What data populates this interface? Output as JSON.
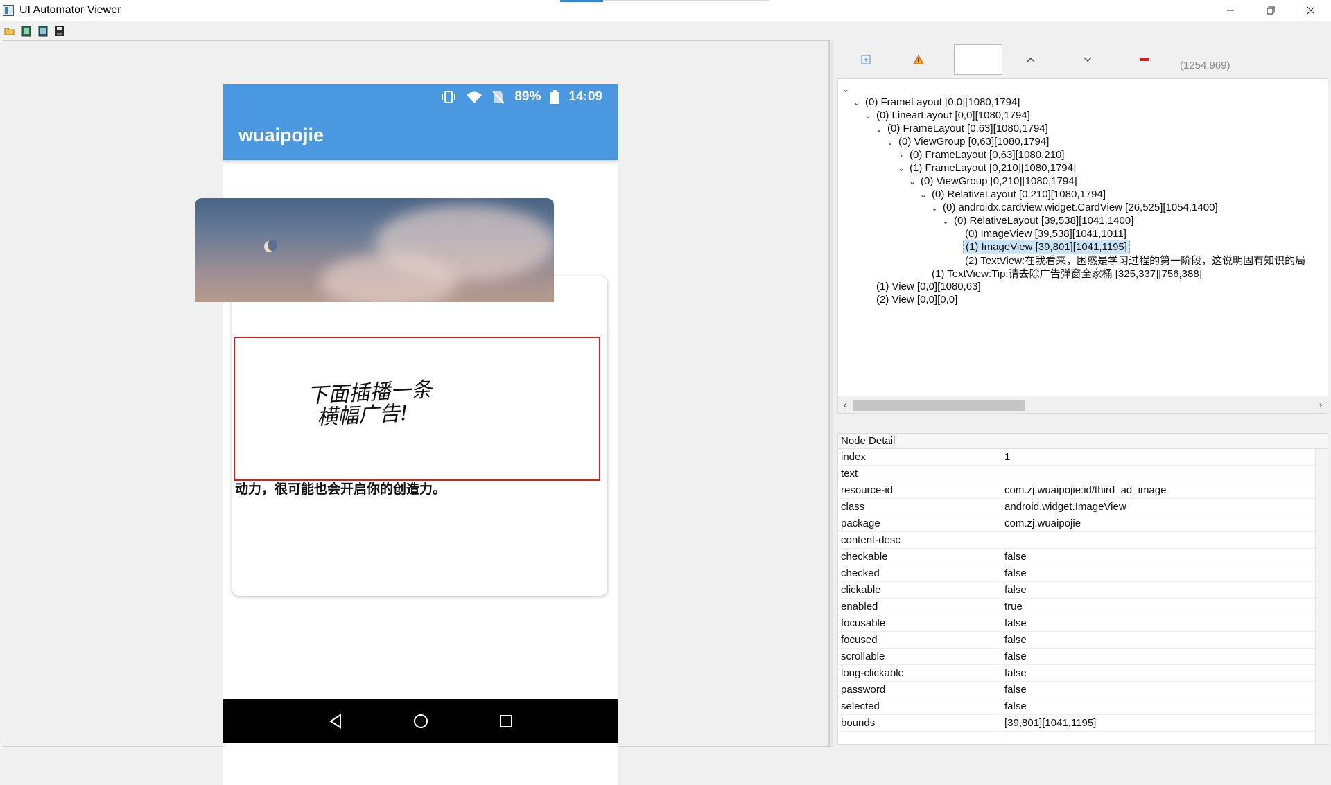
{
  "window": {
    "title": "UI Automator Viewer",
    "controls": [
      "minimize",
      "restore",
      "close"
    ]
  },
  "toolbar": {
    "buttons": [
      "open-icon",
      "device-screenshot-icon",
      "device-screenshot-compressed-icon",
      "save-icon"
    ]
  },
  "device": {
    "status": {
      "battery": "89%",
      "time": "14:09"
    },
    "app_title": "wuaipojie",
    "tip": "Tip:请去除广告弹窗全家桶",
    "ad_text_line1": "下面插播一条",
    "ad_text_line2": "横幅广告!",
    "card_text": "动力，很可能也会开启你的创造力。",
    "nav": [
      "back-icon",
      "home-icon",
      "recents-icon"
    ]
  },
  "hierarchy": {
    "coords": "(1254,969)",
    "nodes": [
      {
        "indent": 0,
        "arrow": "v",
        "label": ""
      },
      {
        "indent": 1,
        "arrow": "v",
        "label": "(0) FrameLayout [0,0][1080,1794]"
      },
      {
        "indent": 2,
        "arrow": "v",
        "label": "(0) LinearLayout [0,0][1080,1794]"
      },
      {
        "indent": 3,
        "arrow": "v",
        "label": "(0) FrameLayout [0,63][1080,1794]"
      },
      {
        "indent": 4,
        "arrow": "v",
        "label": "(0) ViewGroup [0,63][1080,1794]"
      },
      {
        "indent": 5,
        "arrow": ">",
        "label": "(0) FrameLayout [0,63][1080,210]"
      },
      {
        "indent": 5,
        "arrow": "v",
        "label": "(1) FrameLayout [0,210][1080,1794]"
      },
      {
        "indent": 6,
        "arrow": "v",
        "label": "(0) ViewGroup [0,210][1080,1794]"
      },
      {
        "indent": 7,
        "arrow": "v",
        "label": "(0) RelativeLayout [0,210][1080,1794]"
      },
      {
        "indent": 8,
        "arrow": "v",
        "label": "(0) androidx.cardview.widget.CardView [26,525][1054,1400]"
      },
      {
        "indent": 9,
        "arrow": "v",
        "label": "(0) RelativeLayout [39,538][1041,1400]"
      },
      {
        "indent": 10,
        "arrow": "",
        "label": "(0) ImageView [39,538][1041,1011]"
      },
      {
        "indent": 10,
        "arrow": "",
        "label": "(1) ImageView [39,801][1041,1195]",
        "selected": true
      },
      {
        "indent": 10,
        "arrow": "",
        "label": "(2) TextView:在我看来，困惑是学习过程的第一阶段，这说明固有知识的局"
      },
      {
        "indent": 7,
        "arrow": "",
        "label": "(1) TextView:Tip:请去除广告弹窗全家桶 [325,337][756,388]"
      },
      {
        "indent": 2,
        "arrow": "",
        "label": "(1) View [0,0][1080,63]"
      },
      {
        "indent": 2,
        "arrow": "",
        "label": "(2) View [0,0][0,0]"
      }
    ]
  },
  "node_detail": {
    "title": "Node Detail",
    "rows": [
      {
        "key": "index",
        "value": "1"
      },
      {
        "key": "text",
        "value": ""
      },
      {
        "key": "resource-id",
        "value": "com.zj.wuaipojie:id/third_ad_image"
      },
      {
        "key": "class",
        "value": "android.widget.ImageView"
      },
      {
        "key": "package",
        "value": "com.zj.wuaipojie"
      },
      {
        "key": "content-desc",
        "value": ""
      },
      {
        "key": "checkable",
        "value": "false"
      },
      {
        "key": "checked",
        "value": "false"
      },
      {
        "key": "clickable",
        "value": "false"
      },
      {
        "key": "enabled",
        "value": "true"
      },
      {
        "key": "focusable",
        "value": "false"
      },
      {
        "key": "focused",
        "value": "false"
      },
      {
        "key": "scrollable",
        "value": "false"
      },
      {
        "key": "long-clickable",
        "value": "false"
      },
      {
        "key": "password",
        "value": "false"
      },
      {
        "key": "selected",
        "value": "false"
      },
      {
        "key": "bounds",
        "value": "[39,801][1041,1195]"
      },
      {
        "key": "",
        "value": ""
      },
      {
        "key": "",
        "value": ""
      }
    ]
  }
}
